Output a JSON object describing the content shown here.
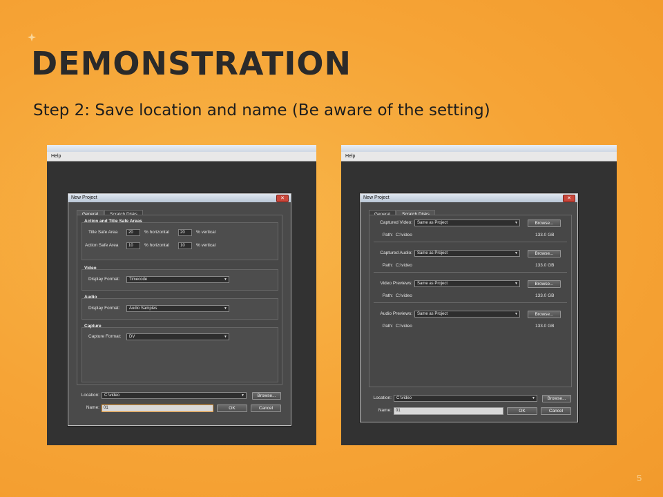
{
  "slide": {
    "title": "DEMONSTRATION",
    "subtitle": "Step 2: Save location and name (Be aware of the setting)",
    "page_number": "5"
  },
  "left_shot": {
    "menu": "Help",
    "dialog_title": "New Project",
    "close_glyph": "✕",
    "tabs": [
      "General",
      "Scratch Disks"
    ],
    "active_tab": "General",
    "safe_areas": {
      "title": "Action and Title Safe Areas",
      "title_safe_label": "Title Safe Area",
      "title_safe_h": "20",
      "title_safe_v": "20",
      "action_safe_label": "Action Safe Area",
      "action_safe_h": "10",
      "action_safe_v": "10",
      "pct_horizontal": "% horizontal",
      "pct_vertical": "% vertical"
    },
    "video": {
      "title": "Video",
      "label": "Display Format:",
      "value": "Timecode"
    },
    "audio": {
      "title": "Audio",
      "label": "Display Format:",
      "value": "Audio Samples"
    },
    "capture": {
      "title": "Capture",
      "label": "Capture Format:",
      "value": "DV"
    },
    "location_label": "Location:",
    "location_value": "C:\\video",
    "browse": "Browse...",
    "name_label": "Name:",
    "name_value": "01",
    "ok": "OK",
    "cancel": "Cancel"
  },
  "right_shot": {
    "menu": "Help",
    "dialog_title": "New Project",
    "close_glyph": "✕",
    "tabs": [
      "General",
      "Scratch Disks"
    ],
    "active_tab": "Scratch Disks",
    "rows": [
      {
        "label": "Captured Video:",
        "value": "Same as Project",
        "path_label": "Path:",
        "path": "C:\\video",
        "size": "133.0 GB",
        "browse": "Browse..."
      },
      {
        "label": "Captured Audio:",
        "value": "Same as Project",
        "path_label": "Path:",
        "path": "C:\\video",
        "size": "133.0 GB",
        "browse": "Browse..."
      },
      {
        "label": "Video Previews:",
        "value": "Same as Project",
        "path_label": "Path:",
        "path": "C:\\video",
        "size": "133.0 GB",
        "browse": "Browse..."
      },
      {
        "label": "Audio Previews:",
        "value": "Same as Project",
        "path_label": "Path:",
        "path": "C:\\video",
        "size": "133.0 GB",
        "browse": "Browse..."
      }
    ],
    "location_label": "Location:",
    "location_value": "C:\\video",
    "browse": "Browse...",
    "name_label": "Name:",
    "name_value": "01",
    "ok": "OK",
    "cancel": "Cancel"
  },
  "colors": {
    "background": "#f6a436",
    "title": "#2a2a2a",
    "dialog": "#4a4a4a"
  }
}
